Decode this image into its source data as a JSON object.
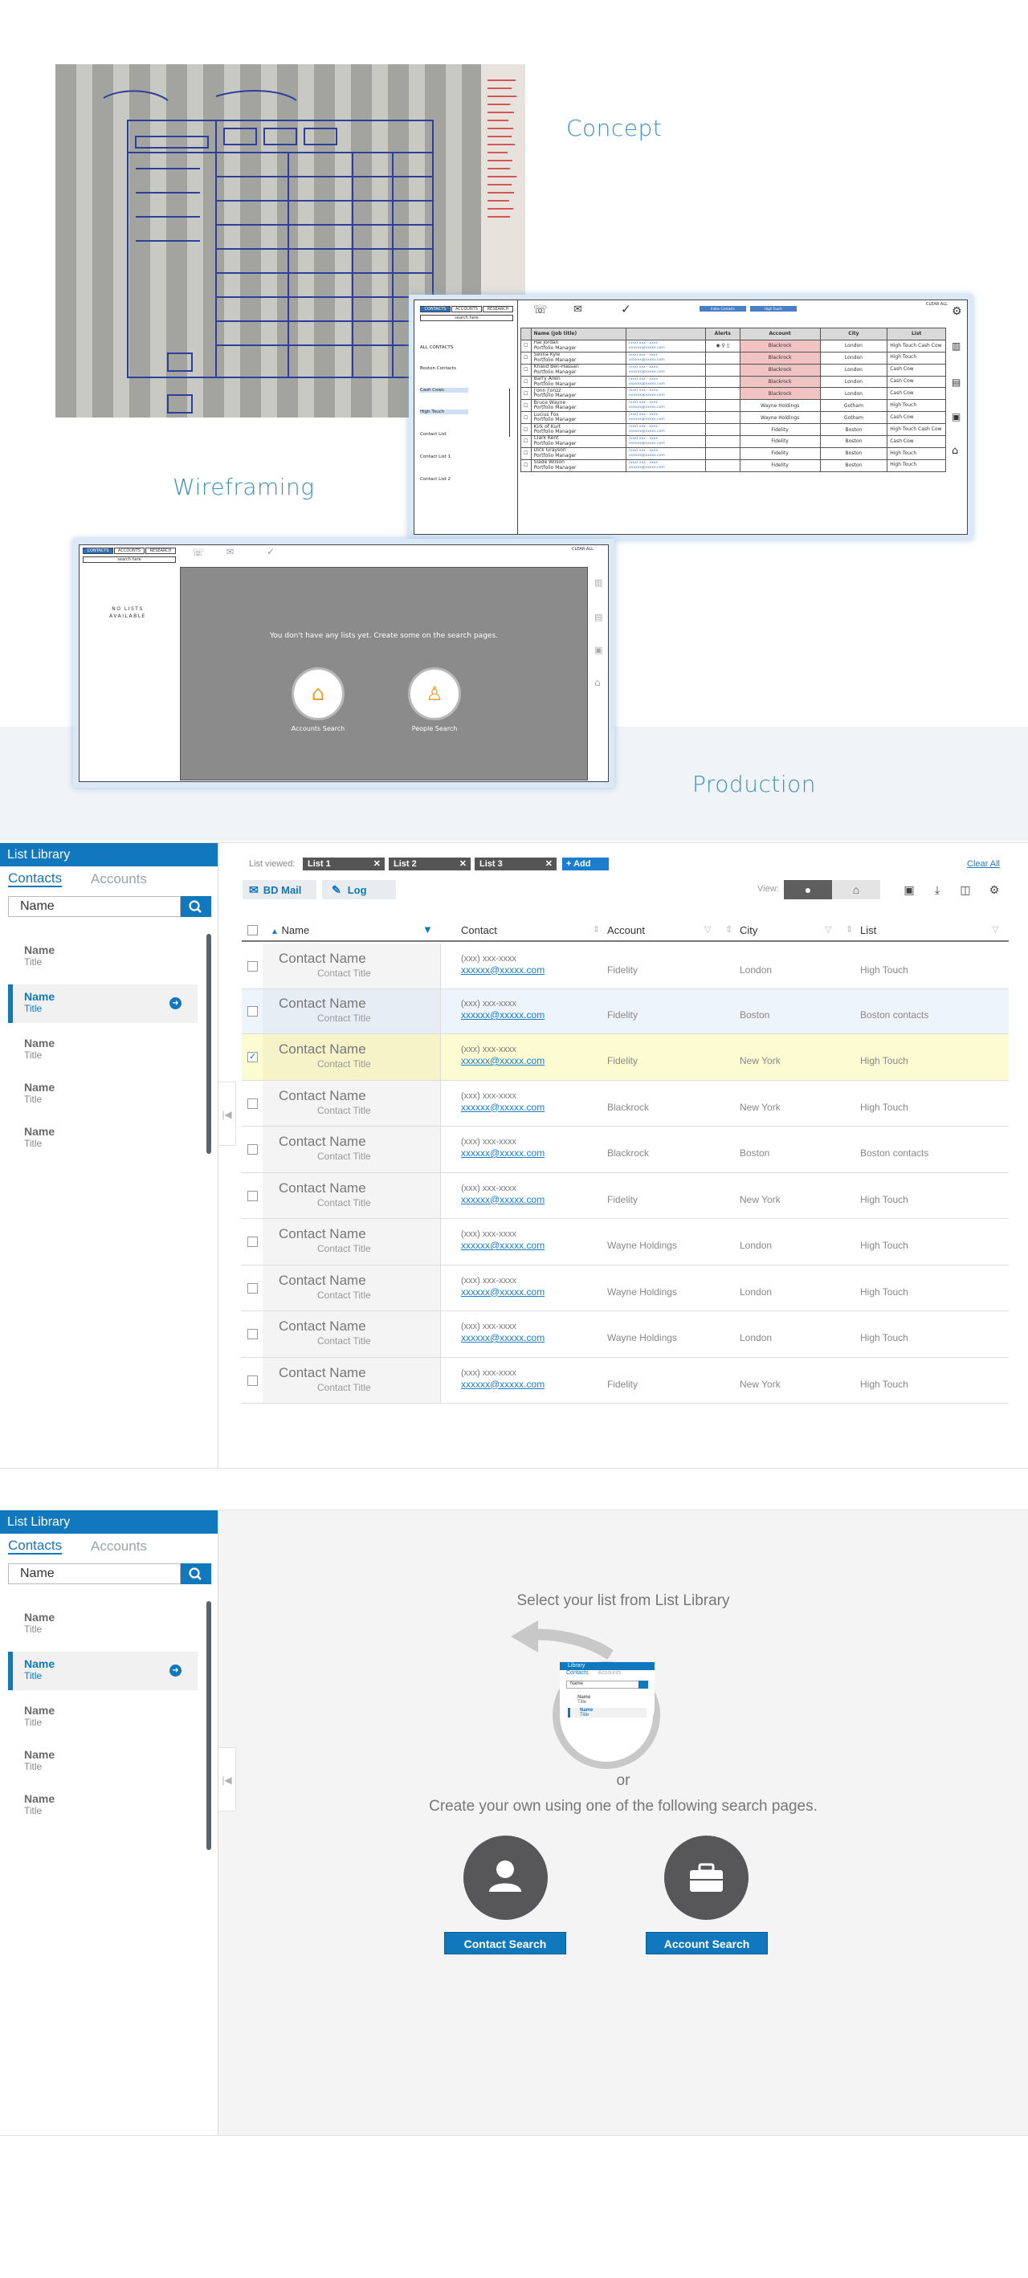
{
  "headings": {
    "concept": "Concept",
    "wireframing": "Wireframing",
    "production": "Production"
  },
  "wireframe_top": {
    "tabs": [
      "CONTACTS",
      "ACCOUNTS",
      "RESEARCH"
    ],
    "search": "search here",
    "lists": [
      "ALL CONTACTS",
      "Boston Contacts",
      "Cash Cows",
      "High Touch",
      "Contact List",
      "Contact List 1",
      "Contact List 2"
    ],
    "chips": [
      "Index Contacts",
      "High Touch"
    ],
    "clear": "CLEAR ALL",
    "columns": [
      "Name (Job title)",
      "Alerts",
      "Account",
      "City",
      "List"
    ],
    "rows": [
      {
        "name": "Hal Jordan",
        "title": "Portfolio Manager",
        "account": "Blackrock",
        "city": "London",
        "list": "High Touch Cash Cow",
        "red": true
      },
      {
        "name": "Selina Kyle",
        "title": "Portfolio Manager",
        "account": "Blackrock",
        "city": "London",
        "list": "High Touch",
        "red": true
      },
      {
        "name": "Khalid Ben-Hassan",
        "title": "Portfolio Manager",
        "account": "Blackrock",
        "city": "London",
        "list": "Cash Cow",
        "red": true
      },
      {
        "name": "Barry Allen",
        "title": "Portfolio Manager",
        "account": "Blackrock",
        "city": "London",
        "list": "Cash Cow",
        "red": true
      },
      {
        "name": "J'onn J'onzz",
        "title": "Portfolio Manager",
        "account": "Blackrock",
        "city": "London",
        "list": "Cash Cow",
        "red": true
      },
      {
        "name": "Bruce Wayne",
        "title": "Portfolio Manager",
        "account": "Wayne Holdings",
        "city": "Gotham",
        "list": "High Touch",
        "red": false
      },
      {
        "name": "Lucius Fox",
        "title": "Portfolio Manager",
        "account": "Wayne Holdings",
        "city": "Gotham",
        "list": "Cash Cow",
        "red": false
      },
      {
        "name": "Kirk of Kurt",
        "title": "Portfolio Manager",
        "account": "Fidelity",
        "city": "Boston",
        "list": "High Touch Cash Cow",
        "red": false
      },
      {
        "name": "Clark Kent",
        "title": "Portfolio Manager",
        "account": "Fidelity",
        "city": "Boston",
        "list": "Cash Cow",
        "red": false
      },
      {
        "name": "Dick Grayson",
        "title": "Portfolio Manager",
        "account": "Fidelity",
        "city": "Boston",
        "list": "High Touch",
        "red": false
      },
      {
        "name": "Slade Wilson",
        "title": "Portfolio Manager",
        "account": "Fidelity",
        "city": "Boston",
        "list": "High Touch",
        "red": false
      }
    ],
    "phone": "(xxx) xxx - xxxx",
    "email": "xxxxxx@xxxxx.com"
  },
  "wireframe_bottom": {
    "tabs": [
      "CONTACTS",
      "ACCOUNTS",
      "RESEARCH"
    ],
    "search": "search here",
    "no_lists": "NO LISTS AVAILABLE",
    "clear": "CLEAR ALL",
    "message": "You don't have any lists yet. Create some on the search pages.",
    "accounts": "Accounts Search",
    "people": "People Search"
  },
  "app": {
    "sidebar": {
      "title": "List Library",
      "tab_contacts": "Contacts",
      "tab_accounts": "Accounts",
      "search_value": "Name",
      "items": [
        {
          "name": "Name",
          "title": "Title"
        },
        {
          "name": "Name",
          "title": "Title"
        },
        {
          "name": "Name",
          "title": "Title"
        },
        {
          "name": "Name",
          "title": "Title"
        },
        {
          "name": "Name",
          "title": "Title"
        }
      ]
    },
    "toolbar": {
      "list_viewed": "List viewed:",
      "lists": [
        "List 1",
        "List 2",
        "List 3"
      ],
      "add": "+ Add",
      "clear_all": "Clear All",
      "bd_mail": "BD Mail",
      "log": "Log",
      "view": "View:"
    },
    "table": {
      "columns": [
        "Name",
        "Contact",
        "Account",
        "City",
        "List"
      ],
      "rows": [
        {
          "name": "Contact Name",
          "title": "Contact Title",
          "phone": "(xxx) xxx-xxxx",
          "email": "xxxxxx@xxxxx.com",
          "account": "Fidelity",
          "city": "London",
          "list": "High Touch"
        },
        {
          "name": "Contact Name",
          "title": "Contact Title",
          "phone": "(xxx) xxx-xxxx",
          "email": "xxxxxx@xxxxx.com",
          "account": "Fidelity",
          "city": "Boston",
          "list": "Boston contacts"
        },
        {
          "name": "Contact Name",
          "title": "Contact Title",
          "phone": "(xxx) xxx-xxxx",
          "email": "xxxxxx@xxxxx.com",
          "account": "Fidelity",
          "city": "New York",
          "list": "High Touch"
        },
        {
          "name": "Contact Name",
          "title": "Contact Title",
          "phone": "(xxx) xxx-xxxx",
          "email": "xxxxxx@xxxxx.com",
          "account": "Blackrock",
          "city": "New York",
          "list": "High Touch"
        },
        {
          "name": "Contact Name",
          "title": "Contact Title",
          "phone": "(xxx) xxx-xxxx",
          "email": "xxxxxx@xxxxx.com",
          "account": "Blackrock",
          "city": "Boston",
          "list": "Boston contacts"
        },
        {
          "name": "Contact Name",
          "title": "Contact Title",
          "phone": "(xxx) xxx-xxxx",
          "email": "xxxxxx@xxxxx.com",
          "account": "Fidelity",
          "city": "New York",
          "list": "High Touch"
        },
        {
          "name": "Contact Name",
          "title": "Contact Title",
          "phone": "(xxx) xxx-xxxx",
          "email": "xxxxxx@xxxxx.com",
          "account": "Wayne Holdings",
          "city": "London",
          "list": "High Touch"
        },
        {
          "name": "Contact Name",
          "title": "Contact Title",
          "phone": "(xxx) xxx-xxxx",
          "email": "xxxxxx@xxxxx.com",
          "account": "Wayne Holdings",
          "city": "London",
          "list": "High Touch"
        },
        {
          "name": "Contact Name",
          "title": "Contact Title",
          "phone": "(xxx) xxx-xxxx",
          "email": "xxxxxx@xxxxx.com",
          "account": "Wayne Holdings",
          "city": "London",
          "list": "High Touch"
        },
        {
          "name": "Contact Name",
          "title": "Contact Title",
          "phone": "(xxx) xxx-xxxx",
          "email": "xxxxxx@xxxxx.com",
          "account": "Fidelity",
          "city": "New York",
          "list": "High Touch"
        }
      ]
    }
  },
  "app2": {
    "sidebar": {
      "title": "List Library",
      "tab_contacts": "Contacts",
      "tab_accounts": "Accounts",
      "search_value": "Name",
      "items": [
        {
          "name": "Name",
          "title": "Title"
        },
        {
          "name": "Name",
          "title": "Title"
        },
        {
          "name": "Name",
          "title": "Title"
        },
        {
          "name": "Name",
          "title": "Title"
        },
        {
          "name": "Name",
          "title": "Title"
        }
      ]
    },
    "select_msg": "Select your list from List Library",
    "or": "or",
    "create_msg": "Create your own using one of the following search  pages.",
    "contact_search": "Contact Search",
    "account_search": "Account Search",
    "thumb": {
      "title": "Library",
      "contacts": "Contacts",
      "accounts": "Accounts",
      "search": "Name",
      "item1": "Name",
      "item1t": "Title",
      "item2": "Name",
      "item2t": "Title"
    }
  }
}
